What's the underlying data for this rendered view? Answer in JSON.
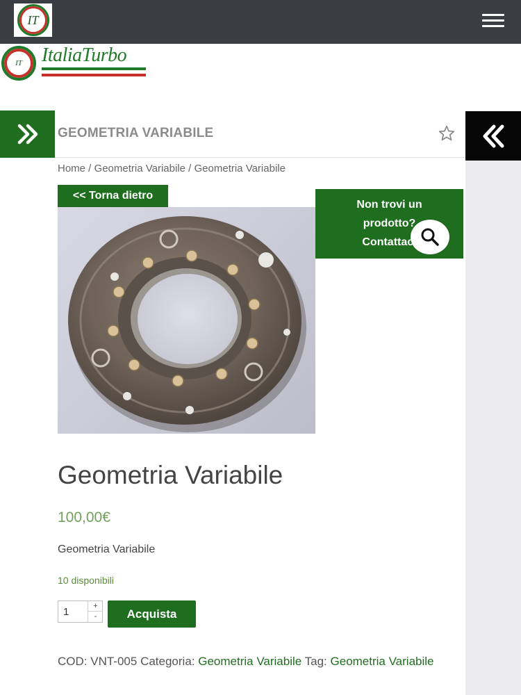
{
  "header": {
    "logo_text": "IT",
    "menu_icon": "hamburger-icon"
  },
  "brand": {
    "name": "ItaliaTurbo",
    "badge_text": "IT",
    "flag_colors": [
      "#1f7a2a",
      "#ffffff",
      "#c8302b"
    ]
  },
  "colors": {
    "accent_green": "#1f6e1f",
    "price_green": "#73a05a",
    "topbar": "#3a3d41"
  },
  "page": {
    "section_title": "GEOMETRIA VARIABILE",
    "breadcrumb": {
      "home": "Home",
      "sep1": " / ",
      "cat": "Geometria Variabile",
      "sep2": " / ",
      "current": "Geometria Variabile"
    },
    "back_button": "<< Torna dietro",
    "cta": {
      "line1": "Non trovi un",
      "line2": "prodotto?",
      "line3": "Contattaci"
    }
  },
  "product": {
    "title": "Geometria Variabile",
    "price": "100,00€",
    "short_description": "Geometria Variabile",
    "stock": "10 disponibili",
    "quantity": "1",
    "buy_label": "Acquista",
    "meta": {
      "cod_label": "COD:",
      "cod_value": "VNT-005",
      "category_label": "Categoria:",
      "category_value": "Geometria Variabile",
      "tag_label": "Tag:",
      "tag_value": "Geometria Variabile"
    }
  }
}
